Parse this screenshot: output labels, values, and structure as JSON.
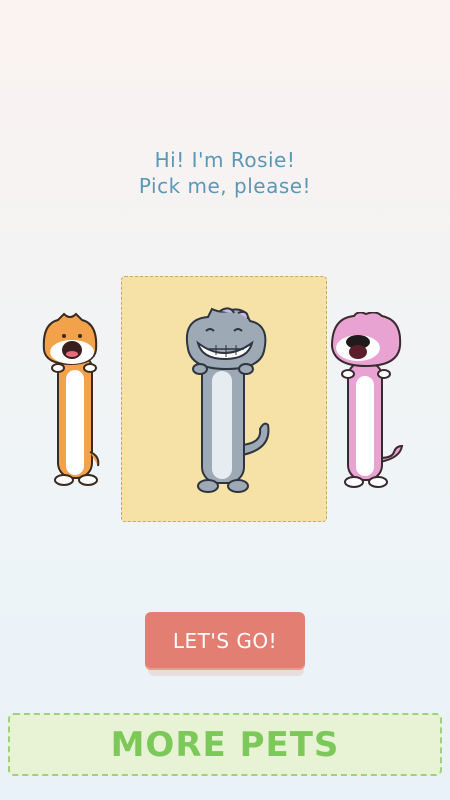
{
  "greeting": {
    "line1": "Hi! I'm Rosie!",
    "line2": "Pick me, please!"
  },
  "pets": [
    {
      "icon": "orange-long-cat-icon",
      "color": "#f2a24a"
    },
    {
      "icon": "gray-long-cat-icon",
      "color": "#9ea9b6",
      "selected": true
    },
    {
      "icon": "pink-long-cat-icon",
      "color": "#e8a3d3"
    }
  ],
  "selection_card_color": "#f6e2a6",
  "buttons": {
    "go_label": "LET'S GO!",
    "more_pets_label": "MORE PETS"
  },
  "colors": {
    "go_button": "#e37f72",
    "more_pets_text": "#7cc95a",
    "greeting_text": "#5a98b8"
  }
}
